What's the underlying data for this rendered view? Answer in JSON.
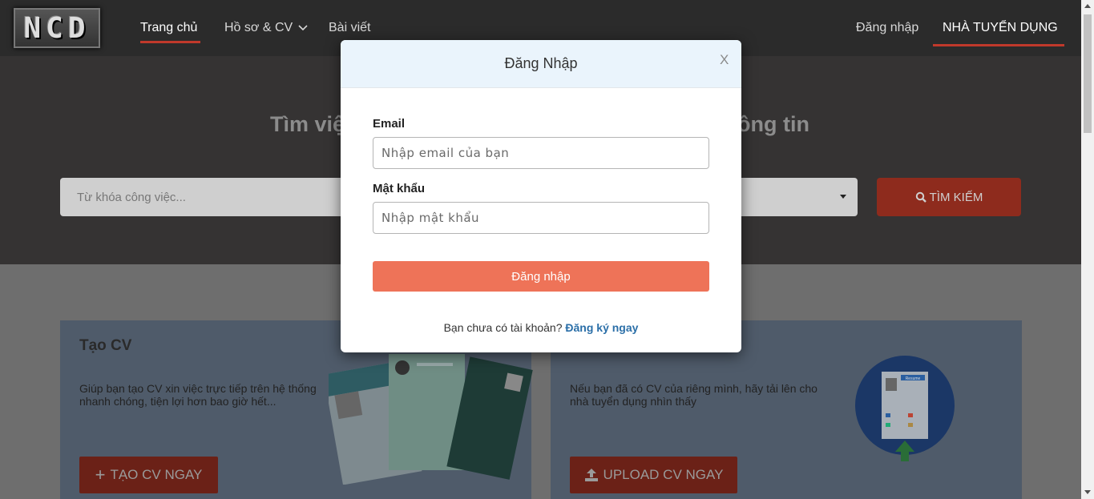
{
  "header": {
    "logo": "NCD",
    "nav": [
      "Trang chủ",
      "Hồ sơ & CV",
      "Bài viết"
    ],
    "login": "Đăng nhập",
    "employer": "NHÀ TUYỂN DỤNG"
  },
  "hero": {
    "title_left": "Tìm việ",
    "title_right": "ông tin",
    "search_placeholder": "Từ khóa công việc...",
    "search_button": "TÌM KIẾM"
  },
  "cards": {
    "create": {
      "title": "Tạo CV",
      "desc": "Giúp bạn tạo CV xin việc trực tiếp trên hệ thống nhanh chóng, tiện lợi hơn bao giờ hết...",
      "button": "TẠO CV NGAY"
    },
    "upload": {
      "desc": "Nếu bạn đã có CV của riêng mình, hãy tải lên cho nhà tuyển dụng nhìn thấy",
      "button": "UPLOAD CV NGAY",
      "resume_label": "Resume"
    }
  },
  "modal": {
    "title": "Đăng Nhập",
    "close": "X",
    "email_label": "Email",
    "email_placeholder": "Nhập email của bạn",
    "password_label": "Mật khẩu",
    "password_placeholder": "Nhập mật khẩu",
    "submit": "Đăng nhập",
    "register_text": "Bạn chưa có tài khoản?",
    "register_link": "Đăng ký ngay"
  },
  "colors": {
    "accent": "#c0392b",
    "submit": "#ee7358",
    "link": "#2b6fa8"
  }
}
